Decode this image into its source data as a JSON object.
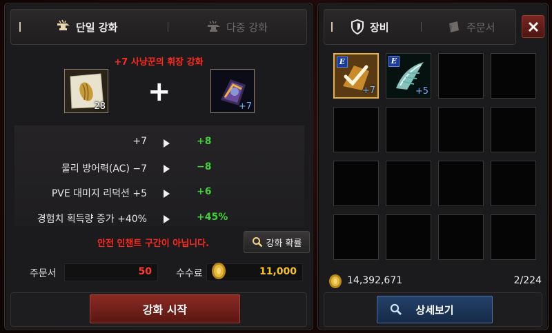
{
  "enchant_panel": {
    "tabs": [
      {
        "label": "단일 강화",
        "icon": "anvil-icon",
        "active": true
      },
      {
        "label": "다중 강화",
        "icon": "multi-anvil-icon",
        "active": false
      }
    ],
    "title": "+7 사냥꾼의 휘장 강화",
    "material_slot": {
      "icon": "enchant-scroll-icon",
      "quantity": "28"
    },
    "target_slot": {
      "icon": "hunter-insignia-icon",
      "quantity": "+7"
    },
    "stats": [
      {
        "label": "+7",
        "value": "+8"
      },
      {
        "label": "물리 방어력(AC) −7",
        "value": "−8"
      },
      {
        "label": "PVE 대미지 리덕션 +5",
        "value": "+6"
      },
      {
        "label": "경험치 획득량 증가 +40%",
        "value": "+45%"
      }
    ],
    "warning": "안전 인챈트 구간이 아닙니다.",
    "rate_button": "강화 확률",
    "scroll_label": "주문서",
    "scroll_count": "50",
    "fee_label": "수수료",
    "fee_value": "11,000",
    "start_button": "강화 시작"
  },
  "inventory_panel": {
    "tabs": [
      {
        "label": "장비",
        "icon": "shield-icon",
        "active": true
      },
      {
        "label": "주문서",
        "icon": "scroll-icon",
        "active": false
      }
    ],
    "items": [
      {
        "icon": "hunter-insignia-icon",
        "badge": "E",
        "quantity": "+7",
        "selected": true
      },
      {
        "icon": "feather-wing-icon",
        "badge": "E",
        "quantity": "+5",
        "selected": false
      }
    ],
    "gold": "14,392,671",
    "slots_used": "2/224",
    "detail_button": "상세보기"
  },
  "colors": {
    "accent_red": "#ff2a1e",
    "stat_green": "#3fd03a",
    "gold_yellow": "#f5c321",
    "selected_border": "#e7b638"
  }
}
